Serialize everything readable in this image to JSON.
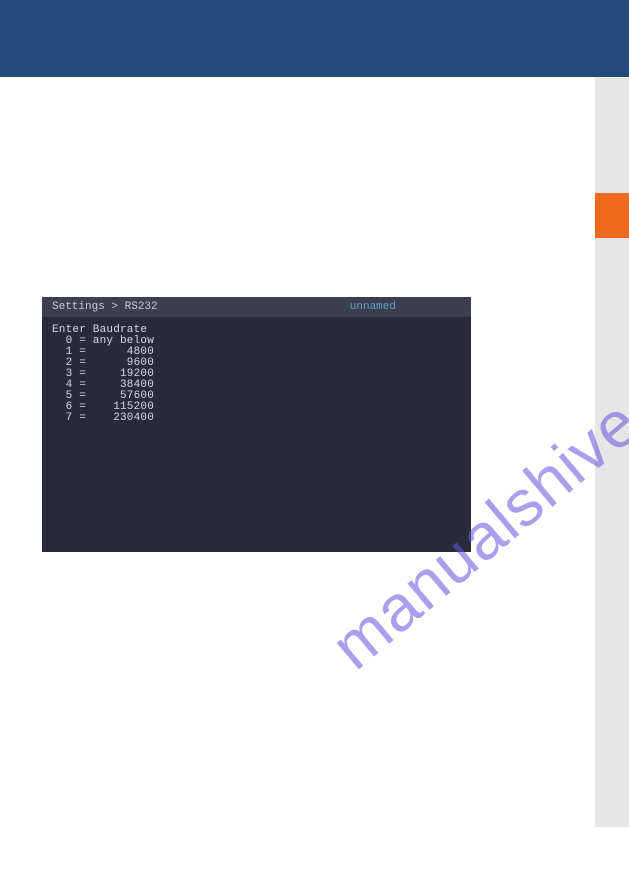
{
  "terminal": {
    "breadcrumb": "Settings > RS232",
    "status": "unnamed",
    "title": "Enter Baudrate",
    "options": [
      {
        "idx": "0",
        "value": "any below"
      },
      {
        "idx": "1",
        "value": "4800"
      },
      {
        "idx": "2",
        "value": "9600"
      },
      {
        "idx": "3",
        "value": "19200"
      },
      {
        "idx": "4",
        "value": "38400"
      },
      {
        "idx": "5",
        "value": "57600"
      },
      {
        "idx": "6",
        "value": "115200"
      },
      {
        "idx": "7",
        "value": "230400"
      }
    ]
  },
  "watermark": "manualshive.com"
}
